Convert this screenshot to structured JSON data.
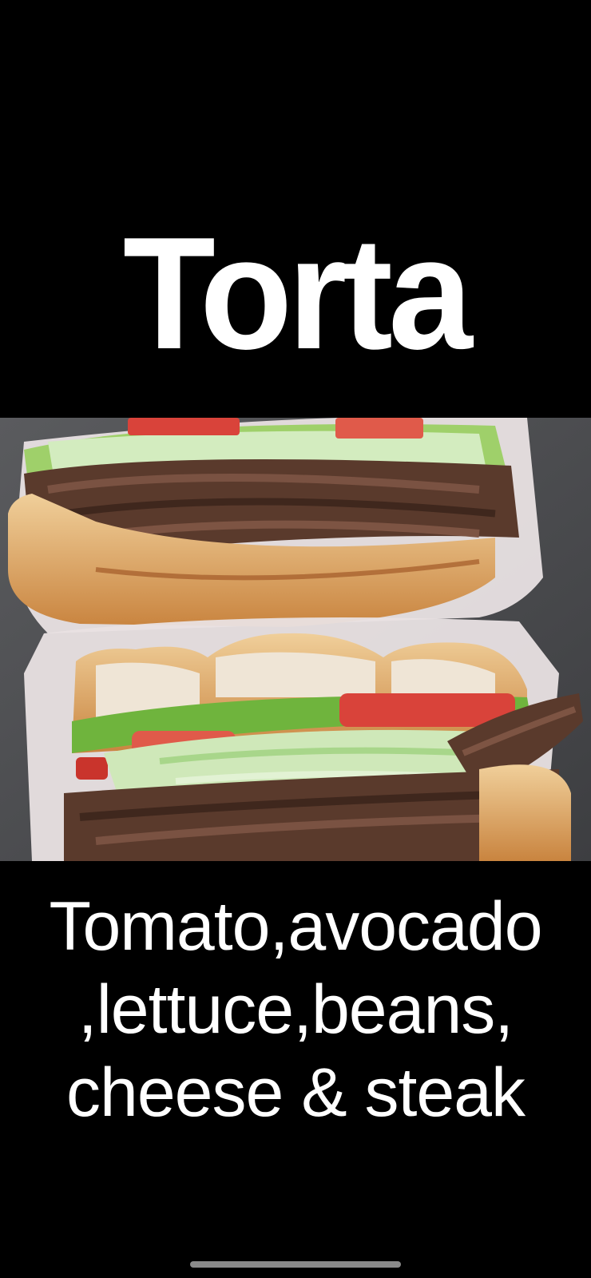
{
  "title": "Torta",
  "caption": {
    "lines": [
      "Tomato,avocado",
      ",lettuce,beans,",
      "cheese & steak"
    ]
  },
  "photo": {
    "subject": "torta sandwich cross-section",
    "colors": {
      "background": "#4a4b4e",
      "bread": "#e2b47a",
      "crust": "#c9803e",
      "steak": "#5a3a2c",
      "lettuce": "#c9e4b4",
      "avocado": "#7fbf4a",
      "tomato": "#d9433a",
      "wrap": "#e8e2e4"
    }
  }
}
